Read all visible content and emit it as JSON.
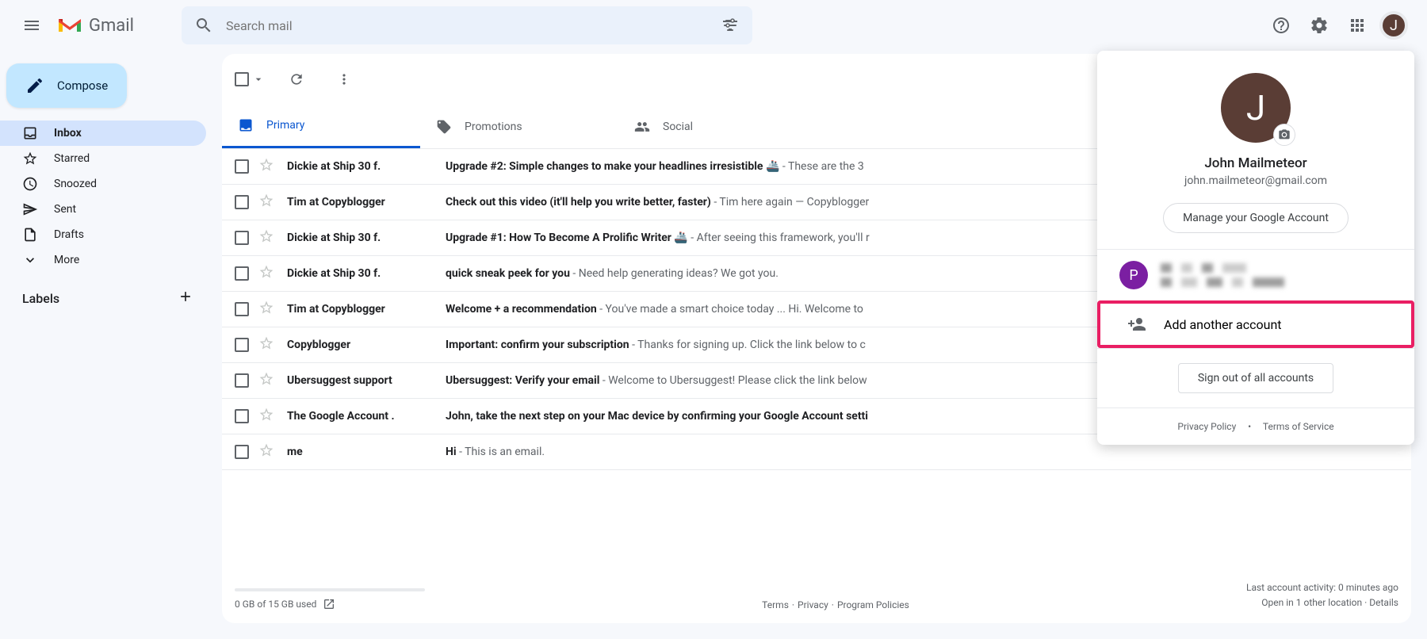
{
  "header": {
    "brand": "Gmail",
    "search_placeholder": "Search mail",
    "avatar_letter": "J"
  },
  "sidebar": {
    "compose_label": "Compose",
    "items": [
      {
        "label": "Inbox"
      },
      {
        "label": "Starred"
      },
      {
        "label": "Snoozed"
      },
      {
        "label": "Sent"
      },
      {
        "label": "Drafts"
      },
      {
        "label": "More"
      }
    ],
    "labels_title": "Labels"
  },
  "tabs": [
    {
      "label": "Primary"
    },
    {
      "label": "Promotions"
    },
    {
      "label": "Social"
    }
  ],
  "emails": [
    {
      "sender": "Dickie at Ship 30 f.",
      "subject": "Upgrade #2: Simple changes to make your headlines irresistible 🚢",
      "preview": " - These are the 3"
    },
    {
      "sender": "Tim at Copyblogger",
      "subject": "Check out this video (it'll help you write better, faster)",
      "preview": " - Tim here again — Copyblogger"
    },
    {
      "sender": "Dickie at Ship 30 f.",
      "subject": "Upgrade #1: How To Become A Prolific Writer 🚢",
      "preview": " - After seeing this framework, you'll r"
    },
    {
      "sender": "Dickie at Ship 30 f.",
      "subject": "quick sneak peek for you",
      "preview": " - Need help generating ideas? We got you."
    },
    {
      "sender": "Tim at Copyblogger",
      "subject": "Welcome + a recommendation",
      "preview": " - You've made a smart choice today ... Hi. Welcome to"
    },
    {
      "sender": "Copyblogger",
      "subject": "Important: confirm your subscription",
      "preview": " - Thanks for signing up. Click the link below to c"
    },
    {
      "sender": "Ubersuggest support",
      "subject": "Ubersuggest: Verify your email",
      "preview": " - Welcome to Ubersuggest! Please click the link below"
    },
    {
      "sender": "The Google Account .",
      "subject": "John, take the next step on your Mac device by confirming your Google Account setti",
      "preview": ""
    },
    {
      "sender": "me",
      "subject": "Hi",
      "preview": " - This is an email."
    }
  ],
  "footer": {
    "storage": "0 GB of 15 GB used",
    "terms": "Terms",
    "privacy": "Privacy",
    "policies": "Program Policies",
    "activity": "Last account activity: 0 minutes ago",
    "open_in": "Open in 1 other location",
    "details": "Details"
  },
  "account_popup": {
    "avatar_letter": "J",
    "name": "John Mailmeteor",
    "email": "john.mailmeteor@gmail.com",
    "manage_label": "Manage your Google Account",
    "other_account_letter": "P",
    "add_account_label": "Add another account",
    "signout_label": "Sign out of all accounts",
    "privacy_policy": "Privacy Policy",
    "terms_service": "Terms of Service",
    "dot": "•"
  }
}
